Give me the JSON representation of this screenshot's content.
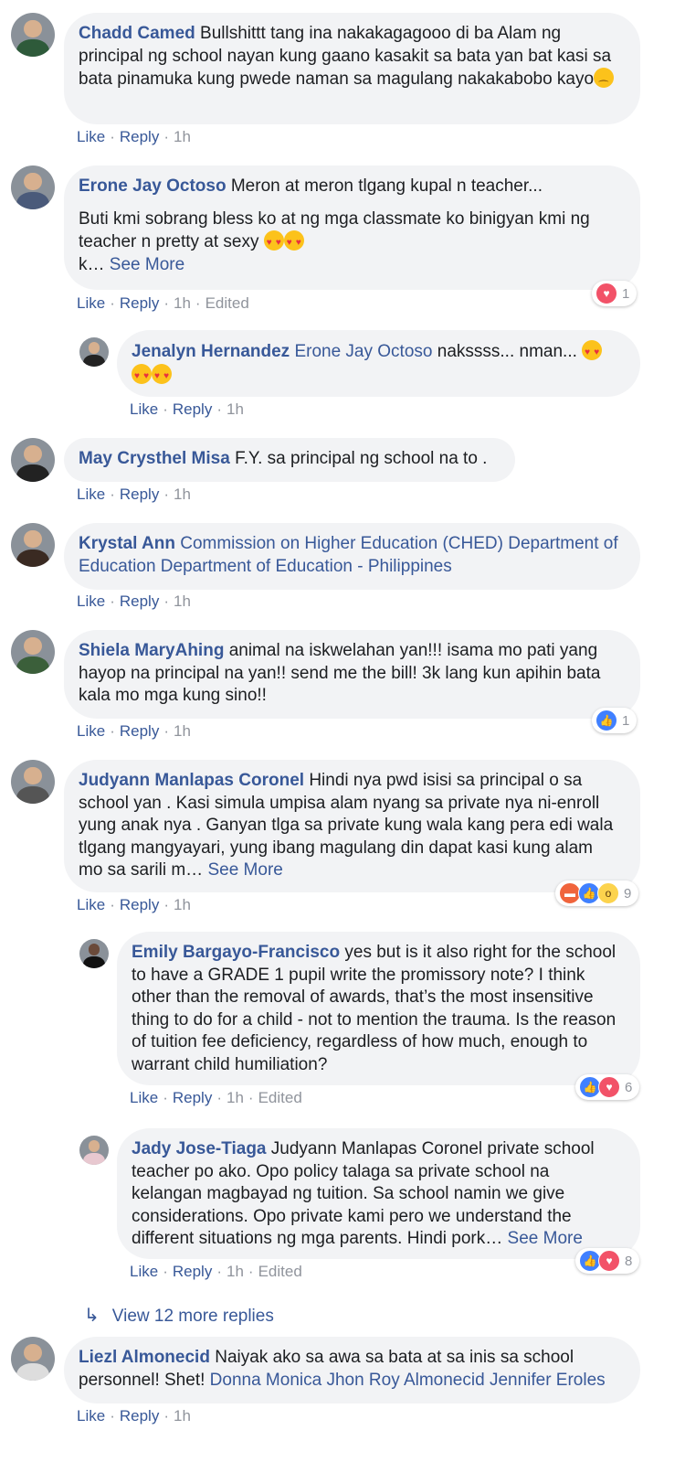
{
  "comments": [
    {
      "name": "Chadd Camed",
      "text": "Bullshittt tang ina nakakagagooo di ba Alam ng principal ng school nayan kung gaano kasakit sa bata yan bat kasi sa bata pinamuka kung pwede naman sa magulang nakakabobo kayo",
      "like": "Like",
      "reply": "Reply",
      "time": "1h"
    },
    {
      "name": "Erone Jay Octoso",
      "text": "Meron at meron tlgang kupal n teacher...",
      "text2": "Buti kmi sobrang bless ko at ng mga classmate ko binigyan kmi ng teacher n pretty at sexy",
      "text3": "k…",
      "see_more": "See More",
      "like": "Like",
      "reply": "Reply",
      "time": "1h",
      "edited": "Edited",
      "reaction_count": "1"
    },
    {
      "name": "Jenalyn Hernandez",
      "mention": "Erone Jay Octoso",
      "text": "nakssss... nman...",
      "like": "Like",
      "reply": "Reply",
      "time": "1h"
    },
    {
      "name": "May Crysthel Misa",
      "text": "F.Y. sa principal ng school na to .",
      "like": "Like",
      "reply": "Reply",
      "time": "1h"
    },
    {
      "name": "Krystal Ann",
      "mention": "Commission on Higher Education (CHED) Department of Education Department of Education - Philippines",
      "like": "Like",
      "reply": "Reply",
      "time": "1h"
    },
    {
      "name": "Shiela MaryAhing",
      "text": "animal na iskwelahan yan!!! isama mo pati yang hayop na principal na yan!! send me the bill! 3k lang kun apihin bata kala mo mga kung sino!!",
      "like": "Like",
      "reply": "Reply",
      "time": "1h",
      "reaction_count": "1"
    },
    {
      "name": "Judyann Manlapas Coronel",
      "text": "Hindi nya pwd isisi sa principal o sa school yan . Kasi simula umpisa alam nyang sa private nya ni-enroll yung anak nya . Ganyan tlga sa private kung wala kang pera edi wala tlgang mangyayari, yung ibang magulang din dapat kasi kung alam mo sa sarili m…",
      "see_more": "See More",
      "like": "Like",
      "reply": "Reply",
      "time": "1h",
      "reaction_count": "9"
    },
    {
      "name": "Emily Bargayo-Francisco",
      "text": "yes but is it also right for the school to have a GRADE 1 pupil write the promissory note? I think other than the removal of awards, that’s the most insensitive thing to do for a child - not to mention the trauma. Is the reason of tuition fee deficiency, regardless of how much, enough to warrant child humiliation?",
      "like": "Like",
      "reply": "Reply",
      "time": "1h",
      "edited": "Edited",
      "reaction_count": "6"
    },
    {
      "name": "Jady Jose-Tiaga",
      "text": "Judyann Manlapas Coronel private school teacher po ako. Opo policy talaga sa private school na kelangan magbayad ng tuition. Sa school namin we give considerations. Opo private kami pero we understand the different situations ng mga parents. Hindi pork…",
      "see_more": "See More",
      "like": "Like",
      "reply": "Reply",
      "time": "1h",
      "edited": "Edited",
      "reaction_count": "8"
    },
    {
      "name": "Liezl Almonecid",
      "text": "Naiyak ako sa awa sa bata at sa inis sa school personnel! Shet!",
      "mention": "Donna Monica Jhon Roy Almonecid Jennifer Eroles",
      "like": "Like",
      "reply": "Reply",
      "time": "1h"
    }
  ],
  "view_more_replies": "View 12 more replies",
  "colors": {
    "link": "#385898",
    "bubble": "#f2f3f5",
    "meta": "#90949c"
  }
}
